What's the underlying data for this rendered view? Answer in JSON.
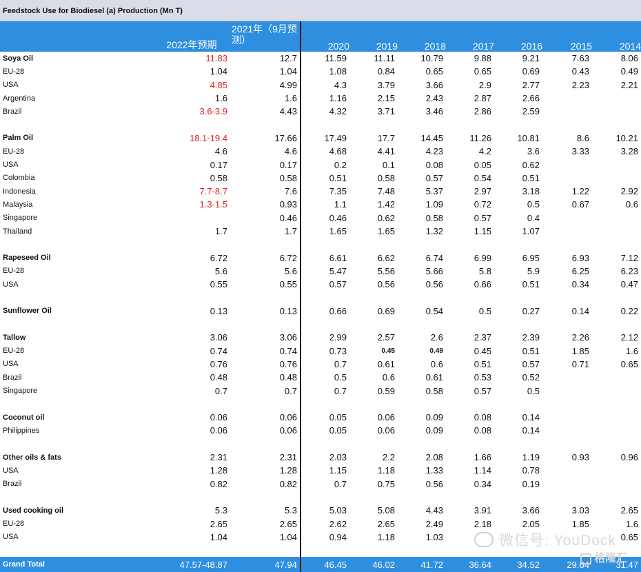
{
  "title": "Feedstock Use for Biodiesel (a) Production (Mn T)",
  "headers": [
    "",
    "2022年预期",
    "2021年（9月预测）",
    "2020",
    "2019",
    "2018",
    "2017",
    "2016",
    "2015",
    "2014"
  ],
  "rows": [
    {
      "type": "group",
      "cells": [
        "Soya Oil",
        "11.83",
        "12.7",
        "11.59",
        "11.11",
        "10.79",
        "9.88",
        "9.21",
        "7.63",
        "8.06"
      ],
      "red": [
        1
      ]
    },
    {
      "type": "item",
      "cells": [
        "EU-28",
        "1.04",
        "1.04",
        "1.08",
        "0.84",
        "0.65",
        "0.65",
        "0.69",
        "0.43",
        "0.49"
      ]
    },
    {
      "type": "item",
      "cells": [
        "USA",
        "4.85",
        "4.99",
        "4.3",
        "3.79",
        "3.66",
        "2.9",
        "2.77",
        "2.23",
        "2.21"
      ],
      "red": [
        1
      ]
    },
    {
      "type": "item",
      "cells": [
        "Argentina",
        "1.6",
        "1.6",
        "1.16",
        "2.15",
        "2.43",
        "2.87",
        "2.66",
        "",
        ""
      ]
    },
    {
      "type": "item",
      "cells": [
        "Brazil",
        "3.6-3.9",
        "4.43",
        "4.32",
        "3.71",
        "3.46",
        "2.86",
        "2.59",
        "",
        ""
      ],
      "red": [
        1
      ]
    },
    {
      "type": "blank"
    },
    {
      "type": "group",
      "cells": [
        "Palm Oil",
        "18.1-19.4",
        "17.66",
        "17.49",
        "17.7",
        "14.45",
        "11.26",
        "10.81",
        "8.6",
        "10.21"
      ],
      "red": [
        1
      ]
    },
    {
      "type": "item",
      "cells": [
        "EU-28",
        "4.6",
        "4.6",
        "4.68",
        "4.41",
        "4.23",
        "4.2",
        "3.6",
        "3.33",
        "3.28"
      ]
    },
    {
      "type": "item",
      "cells": [
        "USA",
        "0.17",
        "0.17",
        "0.2",
        "0.1",
        "0.08",
        "0.05",
        "0.62",
        "",
        ""
      ]
    },
    {
      "type": "item",
      "cells": [
        "Colombia",
        "0.58",
        "0.58",
        "0.51",
        "0.58",
        "0.57",
        "0.54",
        "0.51",
        "",
        ""
      ]
    },
    {
      "type": "item",
      "cells": [
        "Indonesia",
        "7.7-8.7",
        "7.6",
        "7.35",
        "7.48",
        "5.37",
        "2.97",
        "3.18",
        "1.22",
        "2.92"
      ],
      "red": [
        1
      ]
    },
    {
      "type": "item",
      "cells": [
        "Malaysia",
        "1.3-1.5",
        "0.93",
        "1.1",
        "1.42",
        "1.09",
        "0.72",
        "0.5",
        "0.67",
        "0.6"
      ],
      "red": [
        1
      ]
    },
    {
      "type": "item",
      "cells": [
        "Singapore",
        "",
        "0.46",
        "0.46",
        "0.62",
        "0.58",
        "0.57",
        "0.4",
        "",
        ""
      ]
    },
    {
      "type": "item",
      "cells": [
        "Thailand",
        "1.7",
        "1.7",
        "1.65",
        "1.65",
        "1.32",
        "1.15",
        "1.07",
        "",
        ""
      ]
    },
    {
      "type": "blank"
    },
    {
      "type": "group",
      "cells": [
        "Rapeseed Oil",
        "6.72",
        "6.72",
        "6.61",
        "6.62",
        "6.74",
        "6.99",
        "6.95",
        "6.93",
        "7.12"
      ]
    },
    {
      "type": "item",
      "cells": [
        "EU-28",
        "5.6",
        "5.6",
        "5.47",
        "5.56",
        "5.66",
        "5.8",
        "5.9",
        "6.25",
        "6.23"
      ]
    },
    {
      "type": "item",
      "cells": [
        "USA",
        "0.55",
        "0.55",
        "0.57",
        "0.56",
        "0.56",
        "0.66",
        "0.51",
        "0.34",
        "0.47"
      ]
    },
    {
      "type": "blank"
    },
    {
      "type": "group",
      "cells": [
        "Sunflower Oil",
        "0.13",
        "0.13",
        "0.66",
        "0.69",
        "0.54",
        "0.5",
        "0.27",
        "0.14",
        "0.22"
      ]
    },
    {
      "type": "blank"
    },
    {
      "type": "group",
      "cells": [
        "Tallow",
        "3.06",
        "3.06",
        "2.99",
        "2.57",
        "2.6",
        "2.37",
        "2.39",
        "2.26",
        "2.12"
      ]
    },
    {
      "type": "item",
      "cells": [
        "EU-28",
        "0.74",
        "0.74",
        "0.73",
        "0.45",
        "0.49",
        "0.45",
        "0.51",
        "1.85",
        "1.6"
      ],
      "small": [
        4,
        5
      ]
    },
    {
      "type": "item",
      "cells": [
        "USA",
        "0.76",
        "0.76",
        "0.7",
        "0.61",
        "0.6",
        "0.51",
        "0.57",
        "0.71",
        "0.65"
      ]
    },
    {
      "type": "item",
      "cells": [
        "Brazil",
        "0.48",
        "0.48",
        "0.5",
        "0.6",
        "0.61",
        "0.53",
        "0.52",
        "",
        ""
      ]
    },
    {
      "type": "item",
      "cells": [
        "Singapore",
        "0.7",
        "0.7",
        "0.7",
        "0.59",
        "0.58",
        "0.57",
        "0.5",
        "",
        ""
      ]
    },
    {
      "type": "blank"
    },
    {
      "type": "group",
      "cells": [
        "Coconut oil",
        "0.06",
        "0.06",
        "0.05",
        "0.06",
        "0.09",
        "0.08",
        "0.14",
        "",
        ""
      ]
    },
    {
      "type": "item",
      "cells": [
        "Philippines",
        "0.06",
        "0.06",
        "0.05",
        "0.06",
        "0.09",
        "0.08",
        "0.14",
        "",
        ""
      ]
    },
    {
      "type": "blank"
    },
    {
      "type": "group",
      "cells": [
        "Other oils & fats",
        "2.31",
        "2.31",
        "2.03",
        "2.2",
        "2.08",
        "1.66",
        "1.19",
        "0.93",
        "0.96"
      ]
    },
    {
      "type": "item",
      "cells": [
        "USA",
        "1.28",
        "1.28",
        "1.15",
        "1.18",
        "1.33",
        "1.14",
        "0.78",
        "",
        ""
      ]
    },
    {
      "type": "item",
      "cells": [
        "Brazil",
        "0.82",
        "0.82",
        "0.7",
        "0.75",
        "0.56",
        "0.34",
        "0.19",
        "",
        ""
      ]
    },
    {
      "type": "blank"
    },
    {
      "type": "group",
      "cells": [
        "Used cooking oil",
        "5.3",
        "5.3",
        "5.03",
        "5.08",
        "4.43",
        "3.91",
        "3.66",
        "3.03",
        "2.65"
      ]
    },
    {
      "type": "item",
      "cells": [
        "EU-28",
        "2.65",
        "2.65",
        "2.62",
        "2.65",
        "2.49",
        "2.18",
        "2.05",
        "1.85",
        "1.6"
      ]
    },
    {
      "type": "item",
      "cells": [
        "USA",
        "1.04",
        "1.04",
        "0.94",
        "1.18",
        "1.03",
        "",
        "",
        "",
        "0.65"
      ]
    },
    {
      "type": "blank"
    }
  ],
  "total": [
    "Grand Total",
    "47.57-48.87",
    "47.94",
    "46.45",
    "46.02",
    "41.72",
    "36.64",
    "34.52",
    "29.64",
    "31.47"
  ],
  "watermark": "微信号: YouDock",
  "logo": "格隆汇",
  "colors": {
    "header_bg": "#2e8ee0",
    "title_bg": "#d9dde8",
    "highlight": "#e02020"
  }
}
